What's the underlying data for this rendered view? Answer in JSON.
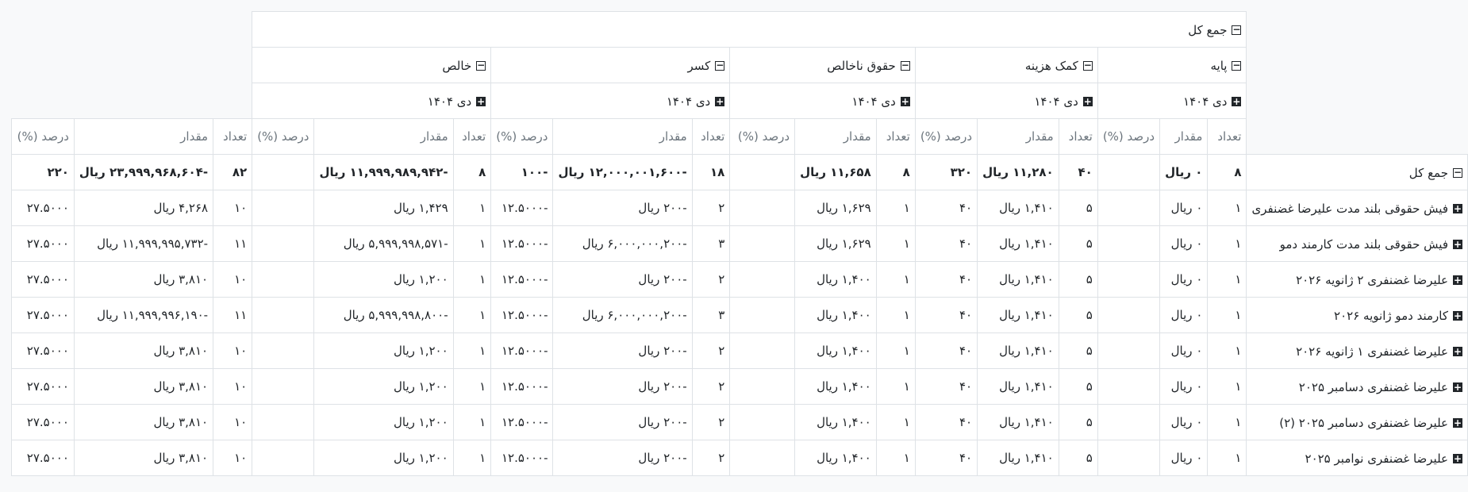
{
  "grand_total_label": "جمع کل",
  "groups": [
    {
      "label": "پایه",
      "period": "دی ۱۴۰۴"
    },
    {
      "label": "کمک هزینه",
      "period": "دی ۱۴۰۴"
    },
    {
      "label": "حقوق ناخالص",
      "period": "دی ۱۴۰۴"
    },
    {
      "label": "کسر",
      "period": "دی ۱۴۰۴"
    },
    {
      "label": "خالص",
      "period": "دی ۱۴۰۴"
    }
  ],
  "measures": {
    "count": "تعداد",
    "amount": "مقدار",
    "percent": "درصد (%)"
  },
  "total_row": {
    "label": "جمع کل",
    "cells": [
      [
        "۸",
        "۰ ریال",
        ""
      ],
      [
        "۴۰",
        "۱۱,۲۸۰ ریال",
        "۳۲۰"
      ],
      [
        "۸",
        "۱۱,۶۵۸ ریال",
        ""
      ],
      [
        "۱۸",
        "-۱۲,۰۰۰,۰۰۱,۶۰۰ ریال",
        "-۱۰۰"
      ],
      [
        "۸",
        "-۱۱,۹۹۹,۹۸۹,۹۴۲ ریال",
        ""
      ],
      [
        "۸۲",
        "-۲۳,۹۹۹,۹۶۸,۶۰۴ ریال",
        "۲۲۰"
      ]
    ]
  },
  "rows": [
    {
      "label": "فیش حقوقی بلند مدت علیرضا غضنفری",
      "cells": [
        [
          "۱",
          "۰ ریال",
          ""
        ],
        [
          "۵",
          "۱,۴۱۰ ریال",
          "۴۰"
        ],
        [
          "۱",
          "۱,۶۲۹ ریال",
          ""
        ],
        [
          "۲",
          "-۲۰۰ ریال",
          "-۱۲.۵۰۰۰"
        ],
        [
          "۱",
          "۱,۴۲۹ ریال",
          ""
        ],
        [
          "۱۰",
          "۴,۲۶۸ ریال",
          "۲۷.۵۰۰۰"
        ]
      ]
    },
    {
      "label": "فیش حقوقی بلند مدت کارمند دمو",
      "cells": [
        [
          "۱",
          "۰ ریال",
          ""
        ],
        [
          "۵",
          "۱,۴۱۰ ریال",
          "۴۰"
        ],
        [
          "۱",
          "۱,۶۲۹ ریال",
          ""
        ],
        [
          "۳",
          "-۶,۰۰۰,۰۰۰,۲۰۰ ریال",
          "-۱۲.۵۰۰۰"
        ],
        [
          "۱",
          "-۵,۹۹۹,۹۹۸,۵۷۱ ریال",
          ""
        ],
        [
          "۱۱",
          "-۱۱,۹۹۹,۹۹۵,۷۳۲ ریال",
          "۲۷.۵۰۰۰"
        ]
      ]
    },
    {
      "label": "علیرضا غضنفری ۲ ژانویه ۲۰۲۶",
      "cells": [
        [
          "۱",
          "۰ ریال",
          ""
        ],
        [
          "۵",
          "۱,۴۱۰ ریال",
          "۴۰"
        ],
        [
          "۱",
          "۱,۴۰۰ ریال",
          ""
        ],
        [
          "۲",
          "-۲۰۰ ریال",
          "-۱۲.۵۰۰۰"
        ],
        [
          "۱",
          "۱,۲۰۰ ریال",
          ""
        ],
        [
          "۱۰",
          "۳,۸۱۰ ریال",
          "۲۷.۵۰۰۰"
        ]
      ]
    },
    {
      "label": "کارمند دمو ژانویه ۲۰۲۶",
      "cells": [
        [
          "۱",
          "۰ ریال",
          ""
        ],
        [
          "۵",
          "۱,۴۱۰ ریال",
          "۴۰"
        ],
        [
          "۱",
          "۱,۴۰۰ ریال",
          ""
        ],
        [
          "۳",
          "-۶,۰۰۰,۰۰۰,۲۰۰ ریال",
          "-۱۲.۵۰۰۰"
        ],
        [
          "۱",
          "-۵,۹۹۹,۹۹۸,۸۰۰ ریال",
          ""
        ],
        [
          "۱۱",
          "-۱۱,۹۹۹,۹۹۶,۱۹۰ ریال",
          "۲۷.۵۰۰۰"
        ]
      ]
    },
    {
      "label": "علیرضا غضنفری ۱ ژانویه ۲۰۲۶",
      "cells": [
        [
          "۱",
          "۰ ریال",
          ""
        ],
        [
          "۵",
          "۱,۴۱۰ ریال",
          "۴۰"
        ],
        [
          "۱",
          "۱,۴۰۰ ریال",
          ""
        ],
        [
          "۲",
          "-۲۰۰ ریال",
          "-۱۲.۵۰۰۰"
        ],
        [
          "۱",
          "۱,۲۰۰ ریال",
          ""
        ],
        [
          "۱۰",
          "۳,۸۱۰ ریال",
          "۲۷.۵۰۰۰"
        ]
      ]
    },
    {
      "label": "علیرضا غضنفری دسامبر ۲۰۲۵",
      "cells": [
        [
          "۱",
          "۰ ریال",
          ""
        ],
        [
          "۵",
          "۱,۴۱۰ ریال",
          "۴۰"
        ],
        [
          "۱",
          "۱,۴۰۰ ریال",
          ""
        ],
        [
          "۲",
          "-۲۰۰ ریال",
          "-۱۲.۵۰۰۰"
        ],
        [
          "۱",
          "۱,۲۰۰ ریال",
          ""
        ],
        [
          "۱۰",
          "۳,۸۱۰ ریال",
          "۲۷.۵۰۰۰"
        ]
      ]
    },
    {
      "label": "علیرضا غضنفری دسامبر ۲۰۲۵ (۲)",
      "cells": [
        [
          "۱",
          "۰ ریال",
          ""
        ],
        [
          "۵",
          "۱,۴۱۰ ریال",
          "۴۰"
        ],
        [
          "۱",
          "۱,۴۰۰ ریال",
          ""
        ],
        [
          "۲",
          "-۲۰۰ ریال",
          "-۱۲.۵۰۰۰"
        ],
        [
          "۱",
          "۱,۲۰۰ ریال",
          ""
        ],
        [
          "۱۰",
          "۳,۸۱۰ ریال",
          "۲۷.۵۰۰۰"
        ]
      ]
    },
    {
      "label": "علیرضا غضنفری نوامبر ۲۰۲۵",
      "cells": [
        [
          "۱",
          "۰ ریال",
          ""
        ],
        [
          "۵",
          "۱,۴۱۰ ریال",
          "۴۰"
        ],
        [
          "۱",
          "۱,۴۰۰ ریال",
          ""
        ],
        [
          "۲",
          "-۲۰۰ ریال",
          "-۱۲.۵۰۰۰"
        ],
        [
          "۱",
          "۱,۲۰۰ ریال",
          ""
        ],
        [
          "۱۰",
          "۳,۸۱۰ ریال",
          "۲۷.۵۰۰۰"
        ]
      ]
    }
  ]
}
